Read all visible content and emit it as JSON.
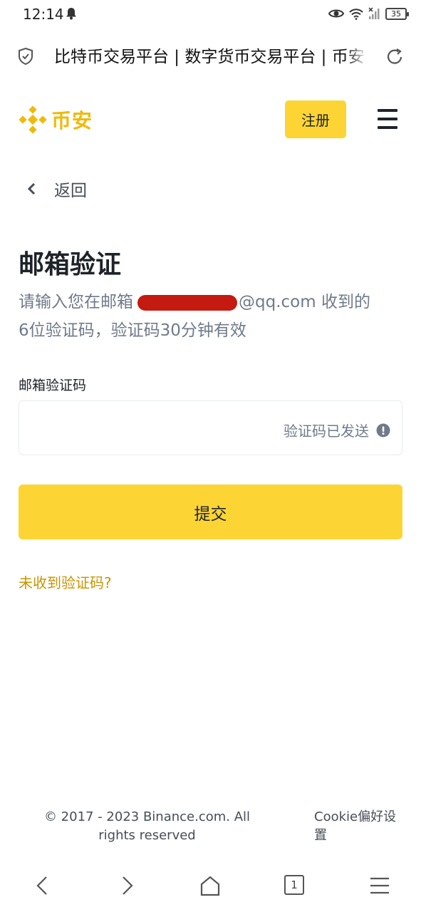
{
  "status_bar": {
    "time": "12:14",
    "battery": "35"
  },
  "browser": {
    "page_title": "比特币交易平台 | 数字货币交易平台 | 币安",
    "tab_count": "1"
  },
  "header": {
    "logo_text": "币安",
    "register_label": "注册",
    "brand_color": "#f0b90b",
    "button_color": "#fcd535"
  },
  "back": {
    "label": "返回"
  },
  "main": {
    "title": "邮箱验证",
    "subtitle_prefix": "请输入您在邮箱",
    "subtitle_email_suffix": "@qq.com 收到的",
    "subtitle_line2": "6位验证码，验证码30分钟有效",
    "field_label": "邮箱验证码",
    "code_value": "",
    "code_status": "验证码已发送",
    "submit_label": "提交",
    "resend_label": "未收到验证码?",
    "link_color": "#c99400"
  },
  "footer": {
    "copyright": "© 2017 - 2023 Binance.com. All rights reserved",
    "cookie_label": "Cookie偏好设置"
  },
  "icons": {
    "status_bell": "bell-icon",
    "eye": "eye-icon",
    "wifi": "wifi-icon",
    "signal": "signal-icon",
    "shield": "shield-check-icon",
    "reload": "reload-icon",
    "logo": "binance-logo-icon",
    "menu": "hamburger-menu-icon",
    "back": "chevron-left-icon",
    "alert": "exclamation-circle-icon",
    "nav_back": "arrow-left-icon",
    "nav_forward": "arrow-right-icon",
    "nav_home": "home-icon",
    "nav_menu": "menu-lines-icon"
  }
}
